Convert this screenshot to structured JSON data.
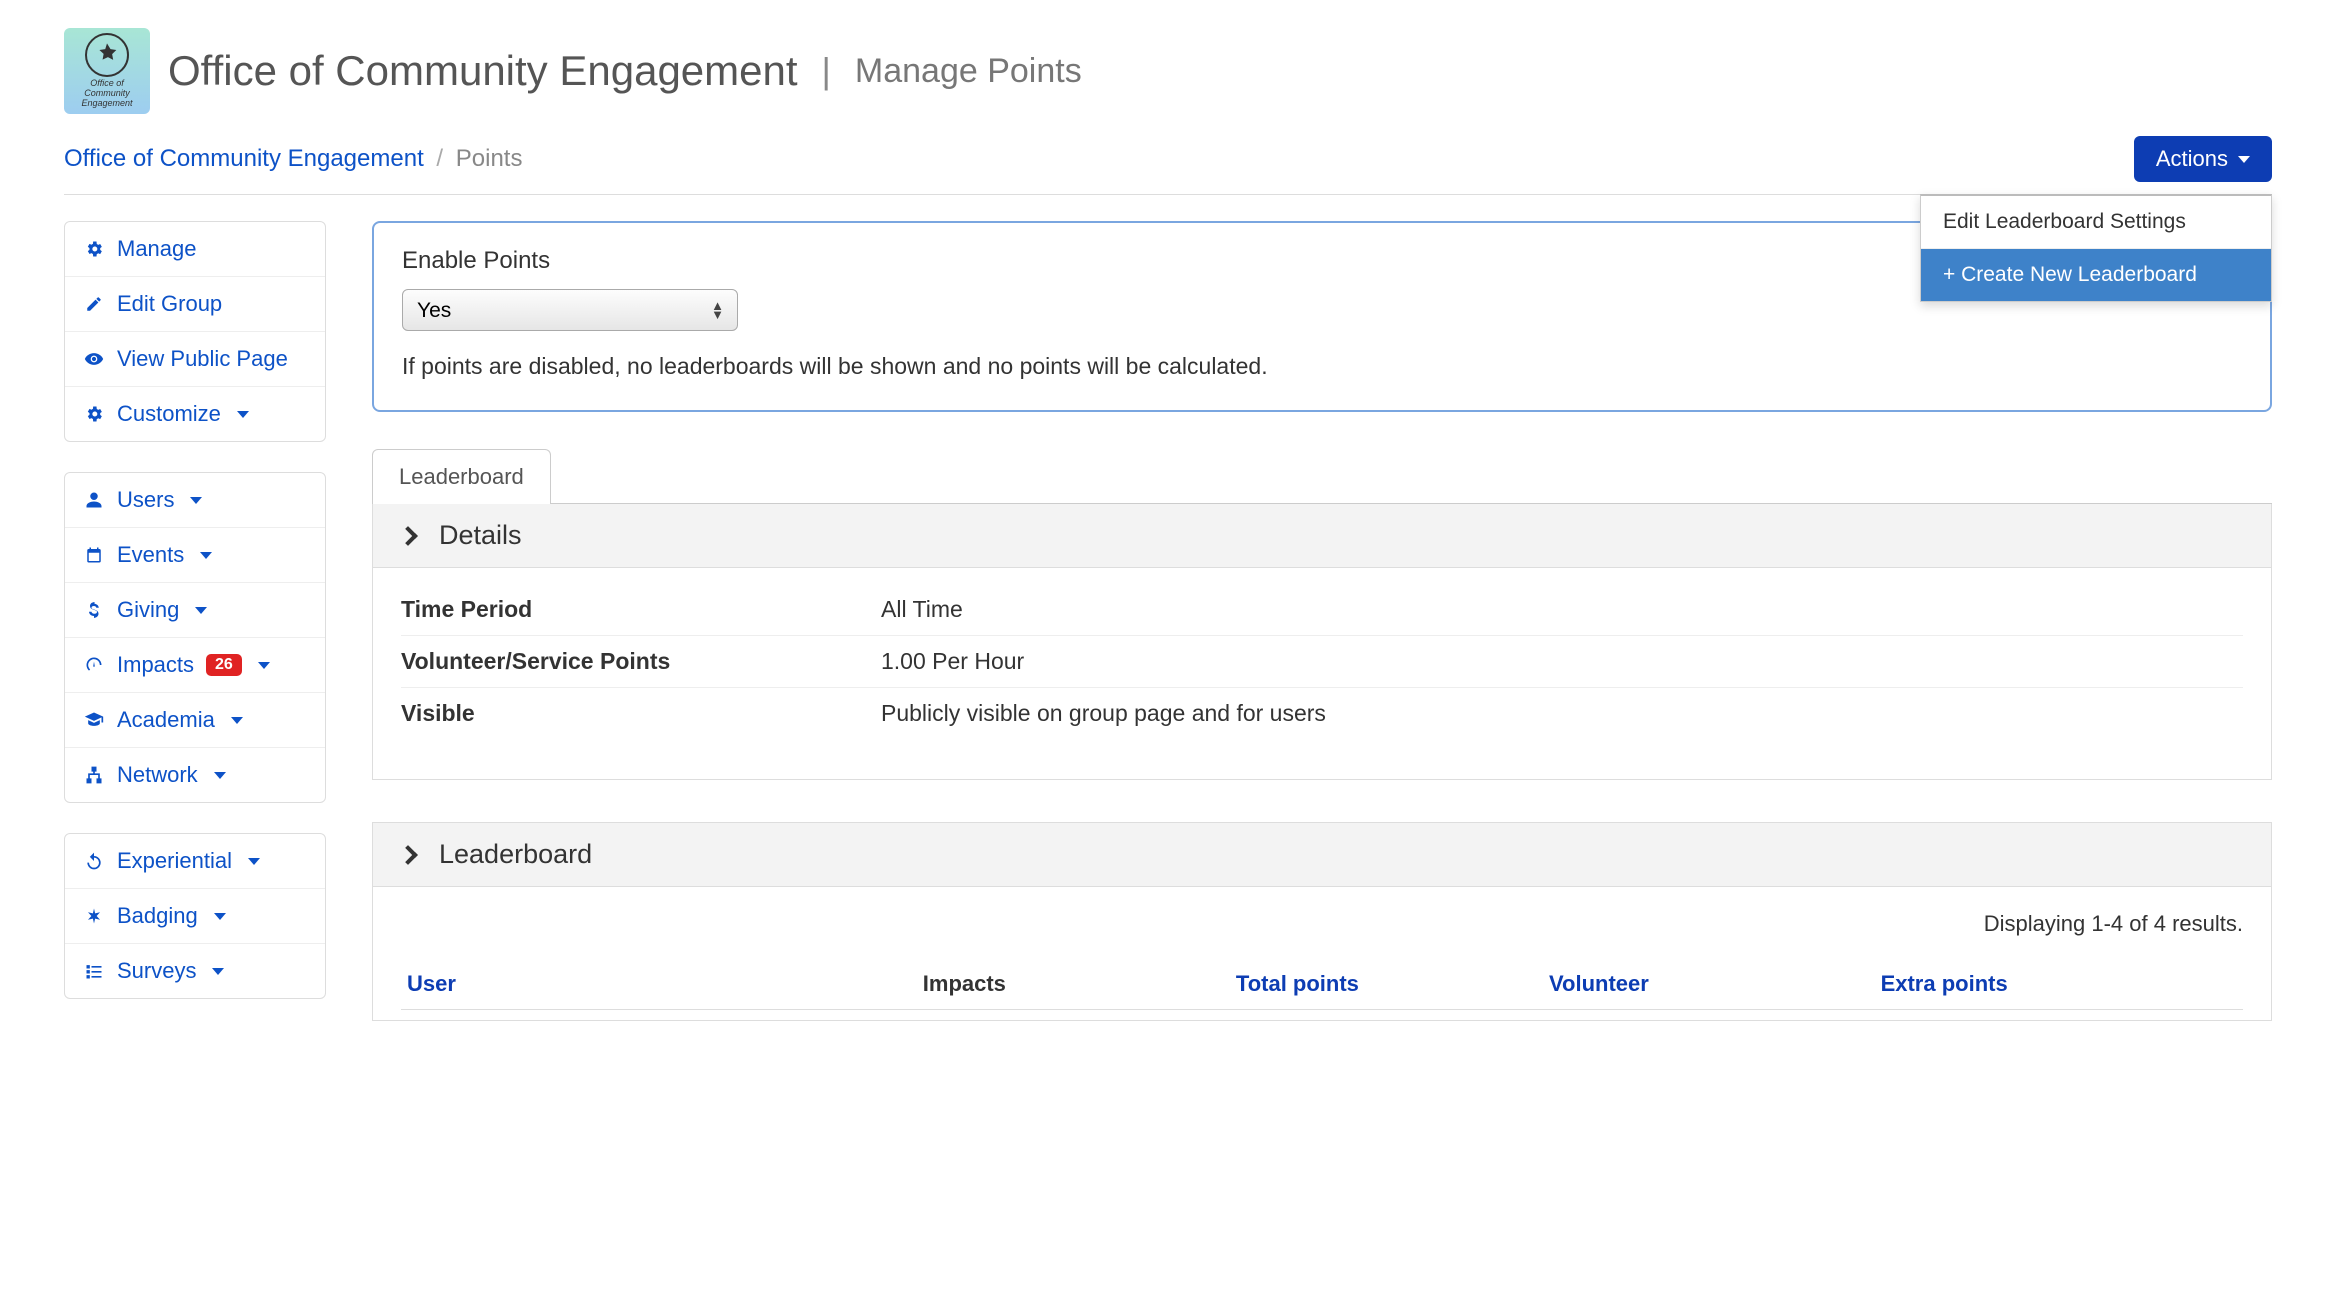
{
  "header": {
    "org_name": "Office of Community Engagement",
    "subtitle": "Manage Points",
    "logo_text_top": "Office of",
    "logo_text_mid": "Community",
    "logo_text_bot": "Engagement"
  },
  "breadcrumb": {
    "root": "Office of Community Engagement",
    "current": "Points"
  },
  "actions": {
    "button_label": "Actions",
    "menu": {
      "edit_settings": "Edit Leaderboard Settings",
      "create_new": "+ Create New Leaderboard"
    }
  },
  "sidebar": {
    "group1": {
      "manage": "Manage",
      "edit_group": "Edit Group",
      "view_public": "View Public Page",
      "customize": "Customize"
    },
    "group2": {
      "users": "Users",
      "events": "Events",
      "giving": "Giving",
      "impacts": "Impacts",
      "impacts_badge": "26",
      "academia": "Academia",
      "network": "Network"
    },
    "group3": {
      "experiential": "Experiential",
      "badging": "Badging",
      "surveys": "Surveys"
    }
  },
  "enable_panel": {
    "label": "Enable Points",
    "select_value": "Yes",
    "helper": "If points are disabled, no leaderboards will be shown and no points will be calculated."
  },
  "tab": {
    "leaderboard": "Leaderboard"
  },
  "details": {
    "header": "Details",
    "rows": {
      "time_period_k": "Time Period",
      "time_period_v": "All Time",
      "vsp_k": "Volunteer/Service Points",
      "vsp_v": "1.00 Per Hour",
      "visible_k": "Visible",
      "visible_v": "Publicly visible on group page and for users"
    }
  },
  "leaderboard": {
    "header": "Leaderboard",
    "results_text": "Displaying 1-4 of 4 results.",
    "columns": {
      "user": "User",
      "impacts": "Impacts",
      "total_points": "Total points",
      "volunteer": "Volunteer",
      "extra_points": "Extra points"
    }
  }
}
